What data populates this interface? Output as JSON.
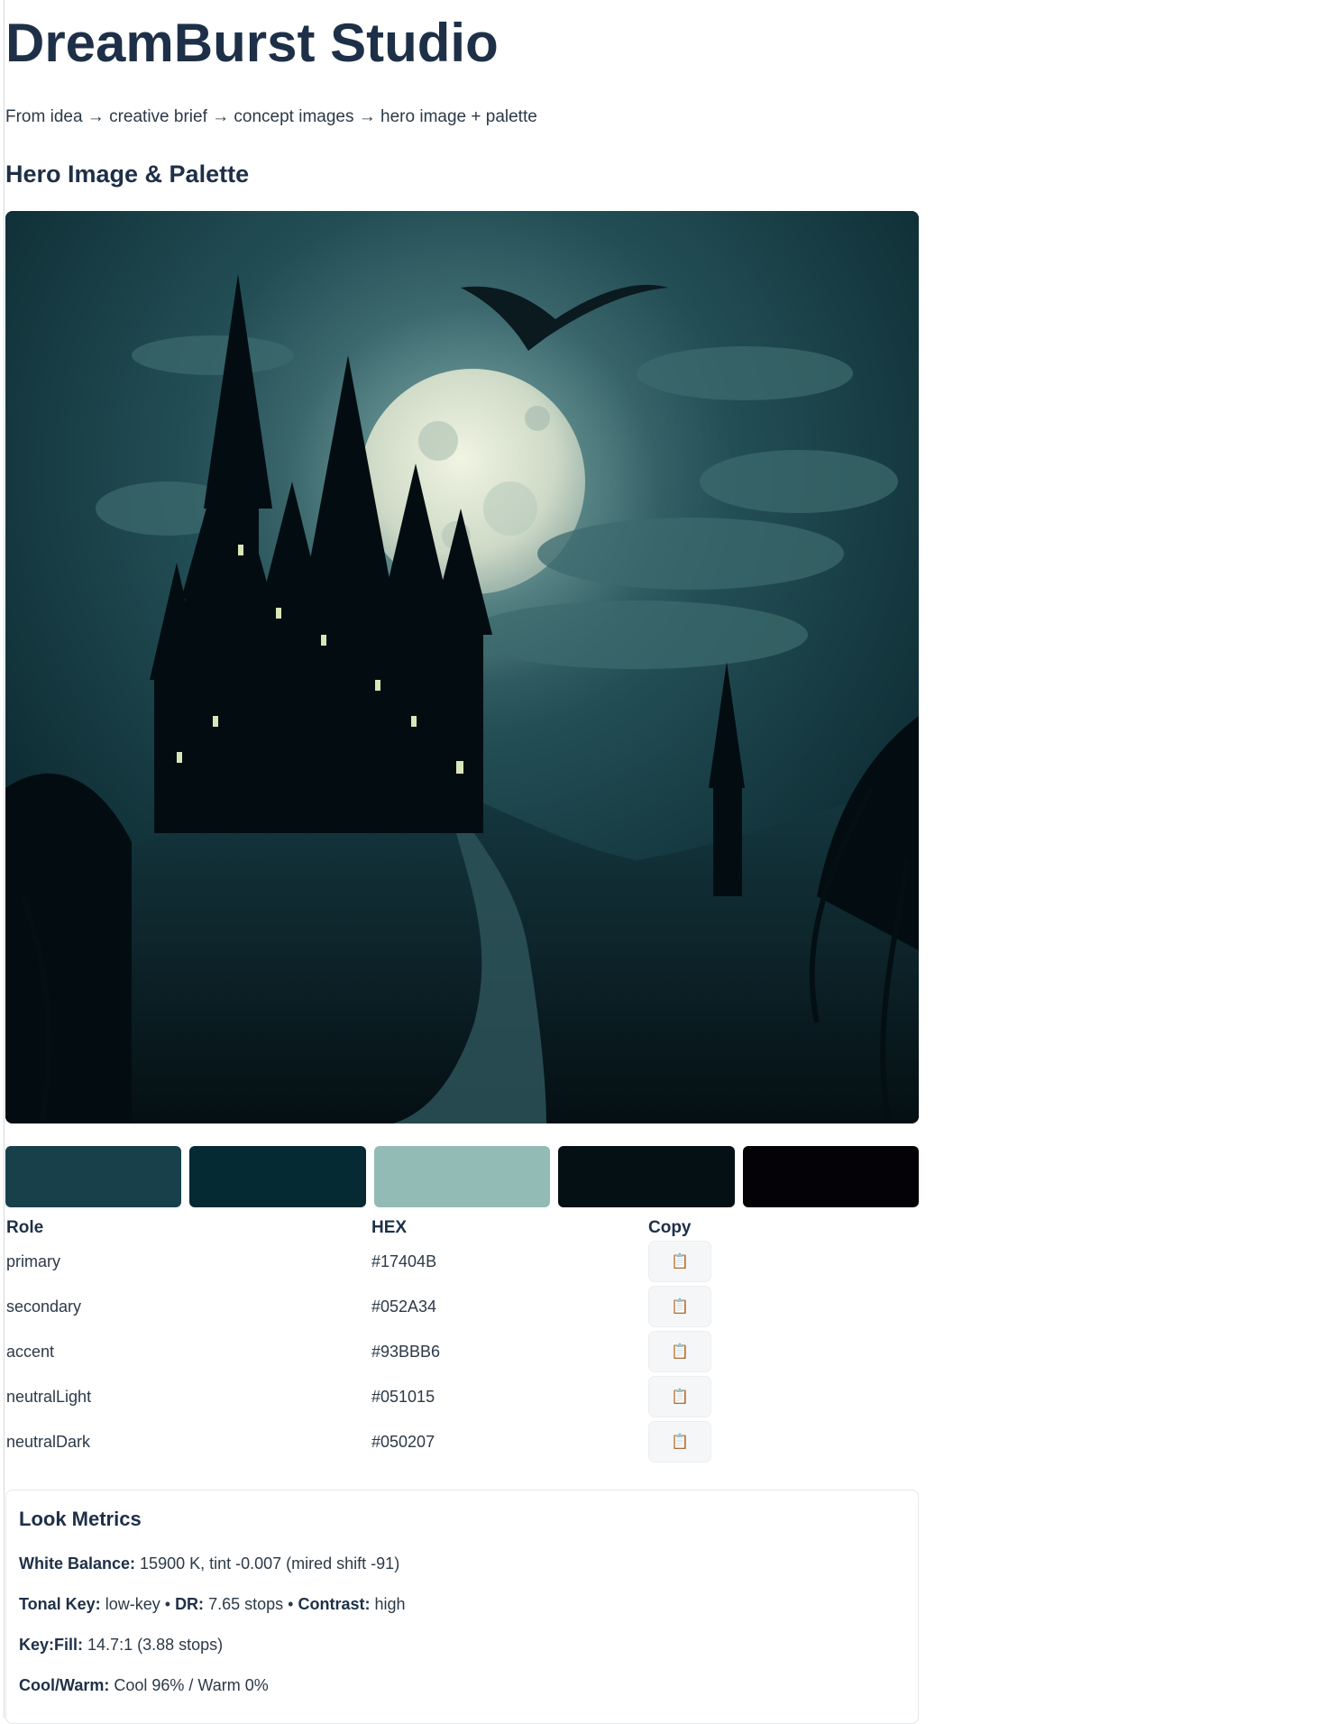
{
  "header": {
    "title": "DreamBurst Studio",
    "subtitle": "From idea → creative brief → concept images → hero image + palette"
  },
  "hero_section": {
    "title": "Hero Image & Palette",
    "image_icon": "hero-image"
  },
  "palette": {
    "columns": {
      "role": "Role",
      "hex": "HEX",
      "copy": "Copy"
    },
    "copy_icon": "clipboard-icon",
    "copy_glyph": "📋",
    "rows": [
      {
        "role": "primary",
        "hex": "#17404B",
        "swatch": "#17404B"
      },
      {
        "role": "secondary",
        "hex": "#052A34",
        "swatch": "#052A34"
      },
      {
        "role": "accent",
        "hex": "#93BBB6",
        "swatch": "#93BBB6"
      },
      {
        "role": "neutralLight",
        "hex": "#051015",
        "swatch": "#051015"
      },
      {
        "role": "neutralDark",
        "hex": "#050207",
        "swatch": "#050207"
      }
    ]
  },
  "metrics": {
    "title": "Look Metrics",
    "white_balance_label": "White Balance:",
    "white_balance_value": "15900 K,  tint -0.007 (mired shift -91)",
    "tonal_key_label": "Tonal Key:",
    "tonal_key_value": "low-key",
    "separator": "•",
    "dr_label": "DR:",
    "dr_value": "7.65 stops",
    "contrast_label": "Contrast:",
    "contrast_value": "high",
    "key_fill_label": "Key:Fill:",
    "key_fill_value": "14.7:1 (3.88 stops)",
    "cool_warm_label": "Cool/Warm:",
    "cool_warm_value": "Cool 96% / Warm 0%"
  }
}
